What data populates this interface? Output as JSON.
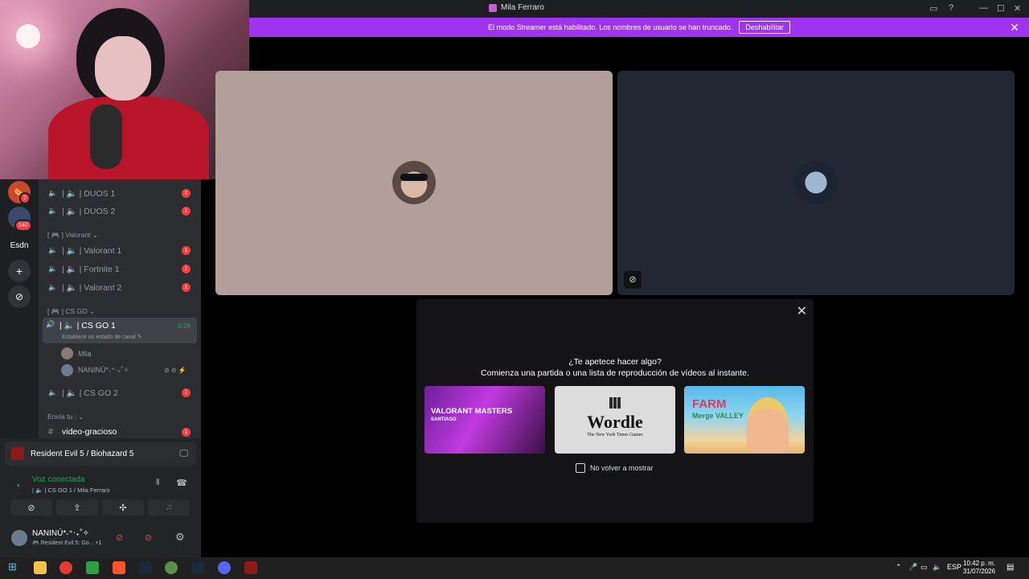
{
  "window": {
    "title": "Mila Ferraro"
  },
  "banner": {
    "text": "El modo Streamer está habilitado. Los nombres de usuario se han truncado.",
    "button": "Deshabilitar"
  },
  "rail": {
    "badges": [
      "2",
      "140"
    ],
    "server_label": "Esdn"
  },
  "channels": {
    "items_top": [
      {
        "label": "| 🔈 | DUOS 1",
        "unread": "1"
      },
      {
        "label": "| 🔈 | DUOS 2",
        "unread": "1"
      }
    ],
    "cat_valorant": "[ 🎮 ] Valorant ⌄",
    "items_valorant": [
      {
        "label": "| 🔈 | Valorant 1",
        "unread": "1"
      },
      {
        "label": "| 🔈 | Fortnite 1",
        "unread": "1"
      },
      {
        "label": "| 🔈 | Valorant 2",
        "unread": "1"
      }
    ],
    "cat_csgo": "[ 🎮 ] CS GO ⌄",
    "active": {
      "label": "| 🔈 | CS GO 1",
      "time": "6:29",
      "status": "Establece un estado de canal ✎"
    },
    "members": [
      "Mila",
      "NANINÚ*˖⁺‧₊˚✧"
    ],
    "csgo2": {
      "label": "| 🔈 | CS GO 2",
      "unread": "1"
    },
    "cat_envia": "Envía tu : ⌄",
    "text_channel": {
      "label": "video-gracioso",
      "unread": "1"
    }
  },
  "panel": {
    "game": "Resident Evil 5 / Biohazard 5",
    "voice_status": "Voz conectada",
    "voice_channel": "| 🔈 | CS GO 1 / Mila Ferraro",
    "username": "NANINÚ*˖⁺‧₊˚✧",
    "user_activity": "🎮 Resident Evil 5: Go...  +1"
  },
  "activity": {
    "question": "¿Te apetece hacer algo?",
    "subtitle": "Comienza una partida o una lista de reproducción de vídeos al instante.",
    "card1": "VALORANT MASTERS",
    "card1_sub": "SANTIAGO",
    "card2": "Wordle",
    "card2_sub": "The New York Times Games",
    "card3": "FARM",
    "card3_sub": "Merge VALLEY",
    "checkbox": "No volver a mostrar"
  },
  "taskbar": {
    "lang": "ESP",
    "time": "10:42 p. m.",
    "date": "31/07/2026"
  },
  "colors": {
    "accent": "#a033f0",
    "green": "#23a55a",
    "red": "#f23f43"
  }
}
